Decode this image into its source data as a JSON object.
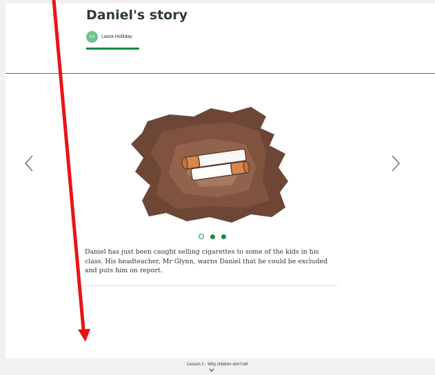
{
  "story": {
    "title": "Daniel's story",
    "author_initials": "LH",
    "author_name": "Laura Holliday"
  },
  "slide": {
    "image_name": "cigarettes-illustration",
    "caption": "Daniel has just been caught selling cigarettes to some of the kids in his class. His headteacher, Mr Glynn, warns Daniel that he could be excluded and puts him on report.",
    "current_index": 1,
    "total": 3
  },
  "icons": {
    "prev": "chevron-left-icon",
    "next": "chevron-right-icon",
    "footer_chevron": "chevron-down-icon"
  },
  "footer": {
    "lesson_label": "Lesson 2 - Why children don't tell"
  },
  "colors": {
    "accent": "#0a8a4a",
    "divider": "#1f8f55",
    "avatar": "#6cc28e",
    "annotation_arrow": "#e8141a"
  }
}
